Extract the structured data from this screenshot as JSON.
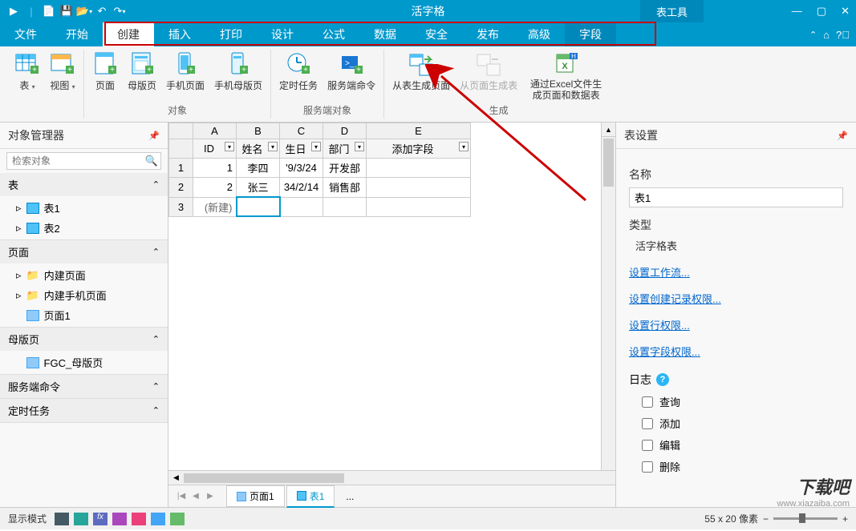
{
  "app": {
    "title": "活字格",
    "tool_tab": "表工具"
  },
  "menus": {
    "file": "文件",
    "home": "开始",
    "create": "创建",
    "insert": "插入",
    "print": "打印",
    "design": "设计",
    "formula": "公式",
    "data": "数据",
    "security": "安全",
    "publish": "发布",
    "advanced": "高级",
    "field": "字段"
  },
  "ribbon": {
    "table": "表",
    "view": "视图",
    "page": "页面",
    "master": "母版页",
    "mobile_page": "手机页面",
    "mobile_master": "手机母版页",
    "scheduled_task": "定时任务",
    "server_cmd": "服务端命令",
    "gen_from_table": "从表生成页面",
    "gen_from_page": "从页面生成表",
    "gen_from_excel": "通过Excel文件生成页面和数据表",
    "group_object": "对象",
    "group_server": "服务端对象",
    "group_generate": "生成"
  },
  "left_panel": {
    "title": "对象管理器",
    "search_placeholder": "检索对象",
    "sections": {
      "tables": "表",
      "pages": "页面",
      "masters": "母版页",
      "server_cmds": "服务端命令",
      "tasks": "定时任务"
    },
    "items": {
      "table1": "表1",
      "table2": "表2",
      "builtin_pages": "内建页面",
      "builtin_mobile": "内建手机页面",
      "page1": "页面1",
      "fgc_master": "FGC_母版页"
    }
  },
  "grid": {
    "cols": [
      "A",
      "B",
      "C",
      "D",
      "E"
    ],
    "fields": {
      "id": "ID",
      "name": "姓名",
      "birthday": "生日",
      "dept": "部门",
      "add": "添加字段"
    },
    "rows": [
      {
        "n": "1",
        "id": "1",
        "name": "李四",
        "birthday": "'9/3/24",
        "dept": "开发部"
      },
      {
        "n": "2",
        "id": "2",
        "name": "张三",
        "birthday": "34/2/14",
        "dept": "销售部"
      }
    ],
    "new_label": "(新建)",
    "row3": "3"
  },
  "sheet_tabs": {
    "page1": "页面1",
    "table1": "表1",
    "more": "..."
  },
  "right_panel": {
    "title": "表设置",
    "name_label": "名称",
    "name_value": "表1",
    "type_label": "类型",
    "type_value": "活字格表",
    "links": {
      "workflow": "设置工作流...",
      "create_perm": "设置创建记录权限...",
      "row_perm": "设置行权限...",
      "field_perm": "设置字段权限..."
    },
    "log_label": "日志",
    "log_options": {
      "query": "查询",
      "add": "添加",
      "edit": "编辑",
      "delete": "删除"
    }
  },
  "statusbar": {
    "mode": "显示模式",
    "size": "55 x 20 像素"
  },
  "watermark": {
    "logo": "下载吧",
    "url": "www.xiazaiba.com"
  }
}
